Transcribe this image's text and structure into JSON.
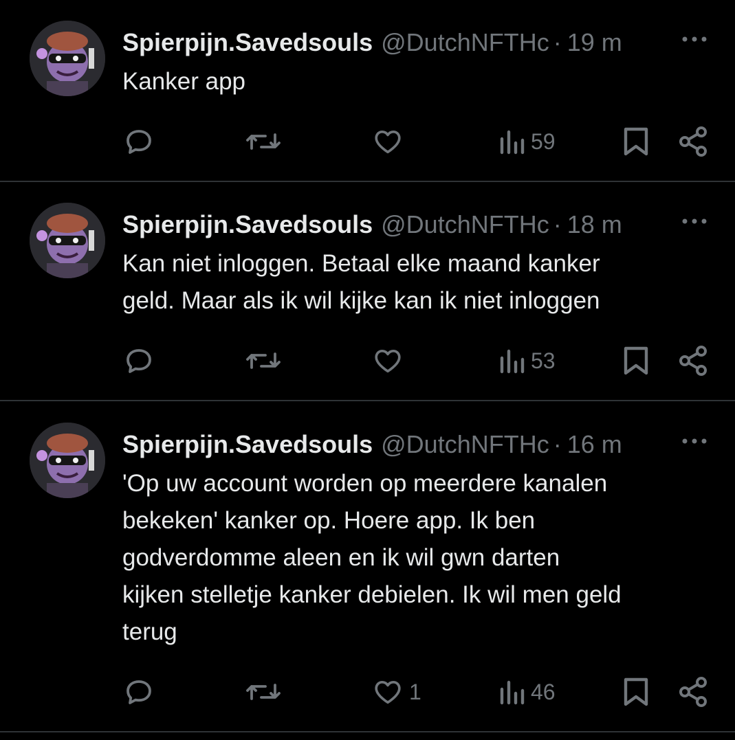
{
  "tweets": [
    {
      "author": "Spierpijn.Savedsouls",
      "handle": "@DutchNFTHc",
      "separator": "·",
      "time": "19 m",
      "lines": [
        "Kanker app"
      ],
      "replies": "",
      "retweets": "",
      "likes": "",
      "views": "59"
    },
    {
      "author": "Spierpijn.Savedsouls",
      "handle": "@DutchNFTHc",
      "separator": "·",
      "time": "18 m",
      "lines": [
        "Kan niet inloggen. Betaal elke maand kanker",
        "geld. Maar als ik wil kijke kan ik niet inloggen"
      ],
      "replies": "",
      "retweets": "",
      "likes": "",
      "views": "53"
    },
    {
      "author": "Spierpijn.Savedsouls",
      "handle": "@DutchNFTHc",
      "separator": "·",
      "time": "16 m",
      "lines": [
        "'Op uw account worden op meerdere kanalen",
        "bekeken' kanker op. Hoere app. Ik ben",
        "godverdomme aleen en ik wil gwn darten",
        "kijken stelletje kanker debielen. Ik wil men geld",
        "terug"
      ],
      "replies": "",
      "retweets": "",
      "likes": "1",
      "views": "46"
    }
  ],
  "icons": {
    "more": "more-horizontal-icon",
    "reply": "reply-icon",
    "retweet": "retweet-icon",
    "like": "heart-icon",
    "views": "views-bar-icon",
    "bookmark": "bookmark-icon",
    "share": "share-icon"
  },
  "colors": {
    "background": "#000000",
    "text": "#e7e9ea",
    "muted": "#71767b",
    "divider": "#2f3336"
  }
}
